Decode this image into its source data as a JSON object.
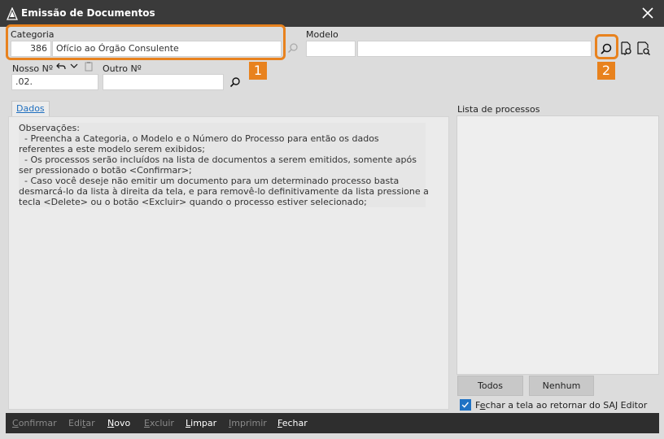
{
  "window": {
    "title": "Emissão de Documentos"
  },
  "categoria": {
    "label": "Categoria",
    "code": "386",
    "description": "Ofício ao Órgão Consulente"
  },
  "modelo": {
    "label": "Modelo",
    "code": "",
    "description": ""
  },
  "nosso_no": {
    "label": "Nosso Nº",
    "value": ".02."
  },
  "outro_no": {
    "label": "Outro Nº",
    "value": ""
  },
  "callouts": {
    "one": "1",
    "two": "2"
  },
  "tab": {
    "label": "Dados"
  },
  "observacoes": {
    "text": "Observações:\n  - Preencha a Categoria, o Modelo e o Número do Processo para então os dados\nreferentes a este modelo serem exibidos;\n  - Os processos serão incluídos na lista de documentos a serem emitidos, somente após\nser pressionado o botão <Confirmar>;\n  - Caso você deseje não emitir um documento para um determinado processo basta\ndesmarcá-lo da lista à direita da tela, e para removê-lo definitivamente da lista pressione a\ntecla <Delete> ou o botão <Excluir> quando o processo estiver selecionado;"
  },
  "lista": {
    "label": "Lista de processos",
    "todos_label": "Todos",
    "nenhum_label": "Nenhum",
    "fechar_checkbox_label_pre": "F",
    "fechar_checkbox_label_ul": "e",
    "fechar_checkbox_label_post": "char a tela ao retornar do SAJ Editor",
    "fechar_checked": true
  },
  "toolbar": {
    "confirmar": {
      "pre": "",
      "ul": "C",
      "post": "onfirmar",
      "enabled": false
    },
    "editar": {
      "pre": "Edi",
      "ul": "t",
      "post": "ar",
      "enabled": false
    },
    "novo": {
      "pre": "",
      "ul": "N",
      "post": "ovo",
      "enabled": true
    },
    "excluir": {
      "pre": "",
      "ul": "E",
      "post": "xcluir",
      "enabled": false
    },
    "limpar": {
      "pre": "",
      "ul": "L",
      "post": "impar",
      "enabled": true
    },
    "imprimir": {
      "pre": "",
      "ul": "I",
      "post": "mprimir",
      "enabled": false
    },
    "fechar": {
      "pre": "",
      "ul": "F",
      "post": "echar",
      "enabled": true
    }
  },
  "colors": {
    "accent": "#e8821e",
    "link": "#1f6fbf",
    "titlebar": "#3a3a3a",
    "toolbar": "#2e2e2e"
  }
}
